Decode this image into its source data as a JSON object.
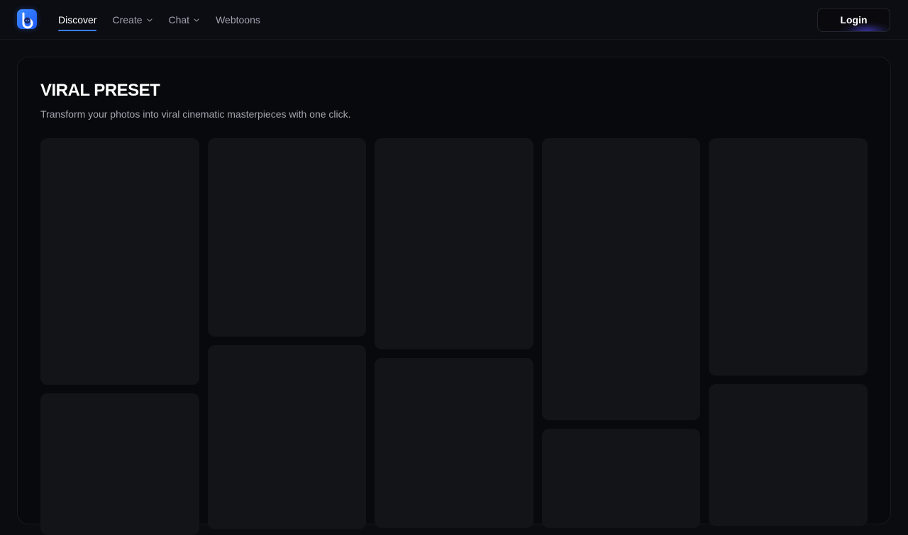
{
  "header": {
    "logo_name": "app-logo",
    "nav": [
      {
        "label": "Discover",
        "active": true,
        "dropdown": false
      },
      {
        "label": "Create",
        "active": false,
        "dropdown": true
      },
      {
        "label": "Chat",
        "active": false,
        "dropdown": true
      },
      {
        "label": "Webtoons",
        "active": false,
        "dropdown": false
      }
    ],
    "login_label": "Login"
  },
  "main": {
    "title": "VIRAL PRESET",
    "subtitle": "Transform your photos into viral cinematic masterpieces with one click."
  },
  "colors": {
    "accent": "#3b7cff",
    "background": "#0b0c10",
    "panel": "#08090c",
    "card": "#131417"
  }
}
